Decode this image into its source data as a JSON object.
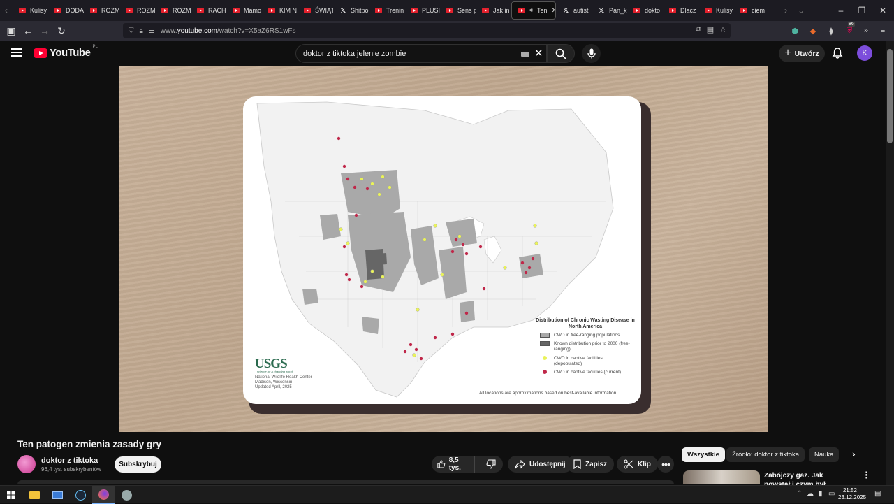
{
  "browser": {
    "tabs": [
      {
        "label": "Kulisy",
        "icon": "youtube-icon"
      },
      {
        "label": "DODA",
        "icon": "youtube-icon"
      },
      {
        "label": "ROZM",
        "icon": "youtube-icon"
      },
      {
        "label": "ROZM",
        "icon": "youtube-icon"
      },
      {
        "label": "ROZM",
        "icon": "youtube-icon"
      },
      {
        "label": "RACH",
        "icon": "youtube-icon"
      },
      {
        "label": "Mamo",
        "icon": "youtube-icon"
      },
      {
        "label": "KIM N",
        "icon": "youtube-icon"
      },
      {
        "label": "ŚWIĄT",
        "icon": "youtube-icon"
      },
      {
        "label": "Shitpo",
        "icon": "x-icon"
      },
      {
        "label": "Trenin",
        "icon": "youtube-icon"
      },
      {
        "label": "PLUSII",
        "icon": "youtube-icon"
      },
      {
        "label": "Sens p",
        "icon": "youtube-icon"
      },
      {
        "label": "Jak in",
        "icon": "youtube-icon"
      },
      {
        "label": "Ten",
        "icon": "youtube-icon",
        "active": true
      },
      {
        "label": "autist",
        "icon": "x-icon"
      },
      {
        "label": "Pan_k",
        "icon": "x-icon"
      },
      {
        "label": "dokto",
        "icon": "youtube-icon"
      },
      {
        "label": "Dlacz",
        "icon": "youtube-icon"
      },
      {
        "label": "Kulisy",
        "icon": "youtube-icon"
      },
      {
        "label": "ciem",
        "icon": "youtube-icon"
      }
    ],
    "url_prefix": "www.",
    "url_host": "youtube.com",
    "url_path": "/watch?v=X5aZ6RS1wFs",
    "ext_badge": "86"
  },
  "youtube": {
    "logo_text": "YouTube",
    "country_code": "PL",
    "search_value": "doktor z tiktoka jelenie zombie",
    "create_label": "Utwórz",
    "avatar_letter": "K"
  },
  "video_frame": {
    "legend_title": "Distribution of Chronic Wasting Disease in North America",
    "legend": [
      {
        "label": "CWD in free-ranging populations",
        "color": "#a9a9a9",
        "kind": "swatch"
      },
      {
        "label": "Known distribution prior to 2000 (free-ranging)",
        "color": "#666666",
        "kind": "swatch"
      },
      {
        "label": "CWD in captive facilities (depopulated)",
        "color": "#e9f25a",
        "kind": "dot"
      },
      {
        "label": "CWD in captive facilities (current)",
        "color": "#c0284a",
        "kind": "dot"
      }
    ],
    "logo": "USGS",
    "logo_tagline": "science for a changing world",
    "credit_lines": [
      "National Wildlife Health Center",
      "Madison, Wisconsin",
      "Updated April, 2025"
    ],
    "footnote": "All locations are approximations based on best-available information"
  },
  "watch": {
    "title": "Ten patogen zmienia zasady gry",
    "channel_name": "doktor z tiktoka",
    "subscribers": "96,4 tys. subskrybentów",
    "subscribe_label": "Subskrybuj",
    "likes": "8,5 tys.",
    "share_label": "Udostępnij",
    "save_label": "Zapisz",
    "clip_label": "Klip"
  },
  "sidebar": {
    "chips": [
      "Wszystkie",
      "Źródło: doktor z tiktoka",
      "Nauka"
    ],
    "rec_title": "Zabójczy gaz. Jak powstał i czym był Cyklon B?"
  },
  "taskbar": {
    "time": "21:52",
    "date": "23.12.2025"
  }
}
